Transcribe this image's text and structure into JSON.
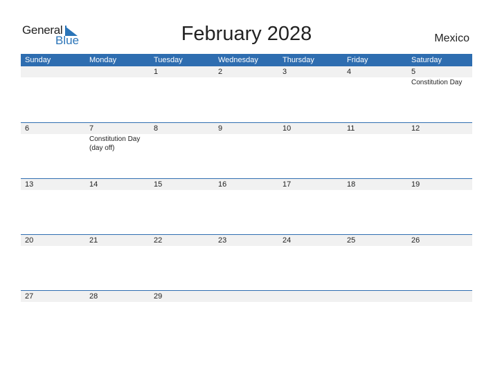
{
  "logo": {
    "general": "General",
    "blue": "Blue",
    "brand_color": "#2a74b8"
  },
  "title": "February 2028",
  "country": "Mexico",
  "header_color": "#2e6db0",
  "weekdays": [
    "Sunday",
    "Monday",
    "Tuesday",
    "Wednesday",
    "Thursday",
    "Friday",
    "Saturday"
  ],
  "weeks": [
    [
      {
        "day": "",
        "event": ""
      },
      {
        "day": "",
        "event": ""
      },
      {
        "day": "1",
        "event": ""
      },
      {
        "day": "2",
        "event": ""
      },
      {
        "day": "3",
        "event": ""
      },
      {
        "day": "4",
        "event": ""
      },
      {
        "day": "5",
        "event": "Constitution Day"
      }
    ],
    [
      {
        "day": "6",
        "event": ""
      },
      {
        "day": "7",
        "event": "Constitution Day (day off)"
      },
      {
        "day": "8",
        "event": ""
      },
      {
        "day": "9",
        "event": ""
      },
      {
        "day": "10",
        "event": ""
      },
      {
        "day": "11",
        "event": ""
      },
      {
        "day": "12",
        "event": ""
      }
    ],
    [
      {
        "day": "13",
        "event": ""
      },
      {
        "day": "14",
        "event": ""
      },
      {
        "day": "15",
        "event": ""
      },
      {
        "day": "16",
        "event": ""
      },
      {
        "day": "17",
        "event": ""
      },
      {
        "day": "18",
        "event": ""
      },
      {
        "day": "19",
        "event": ""
      }
    ],
    [
      {
        "day": "20",
        "event": ""
      },
      {
        "day": "21",
        "event": ""
      },
      {
        "day": "22",
        "event": ""
      },
      {
        "day": "23",
        "event": ""
      },
      {
        "day": "24",
        "event": ""
      },
      {
        "day": "25",
        "event": ""
      },
      {
        "day": "26",
        "event": ""
      }
    ],
    [
      {
        "day": "27",
        "event": ""
      },
      {
        "day": "28",
        "event": ""
      },
      {
        "day": "29",
        "event": ""
      },
      {
        "day": "",
        "event": ""
      },
      {
        "day": "",
        "event": ""
      },
      {
        "day": "",
        "event": ""
      },
      {
        "day": "",
        "event": ""
      }
    ]
  ]
}
